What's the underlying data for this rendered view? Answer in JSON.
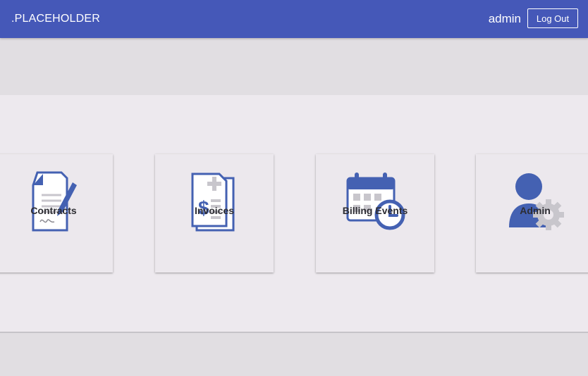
{
  "header": {
    "brand": ".PLACEHOLDER",
    "username": "admin",
    "logout_label": "Log Out"
  },
  "tiles": [
    {
      "label": "Contracts",
      "icon": "contract-icon"
    },
    {
      "label": "Invoices",
      "icon": "invoice-icon"
    },
    {
      "label": "Billing Events",
      "icon": "calendar-clock-icon"
    },
    {
      "label": "Admin",
      "icon": "admin-user-gear-icon"
    }
  ],
  "colors": {
    "header": "#4558b8",
    "icon_blue": "#4461b2",
    "icon_gray": "#c8c6cc",
    "background": "#e1dee2",
    "panel": "#ede9ee"
  }
}
